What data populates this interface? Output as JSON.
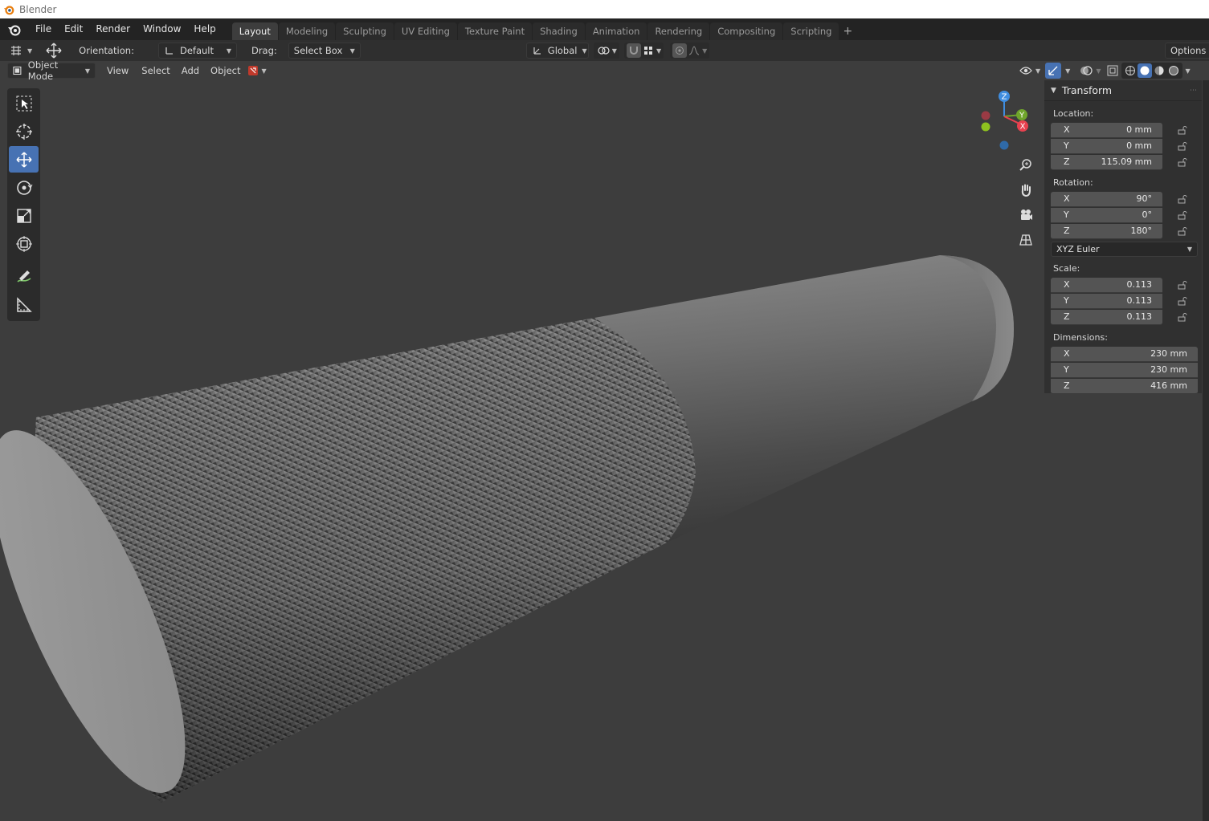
{
  "window": {
    "title": "Blender"
  },
  "menu": [
    "File",
    "Edit",
    "Render",
    "Window",
    "Help"
  ],
  "workspaces": [
    {
      "label": "Layout",
      "active": true
    },
    {
      "label": "Modeling"
    },
    {
      "label": "Sculpting"
    },
    {
      "label": "UV Editing"
    },
    {
      "label": "Texture Paint"
    },
    {
      "label": "Shading"
    },
    {
      "label": "Animation"
    },
    {
      "label": "Rendering"
    },
    {
      "label": "Compositing"
    },
    {
      "label": "Scripting"
    }
  ],
  "tool_header": {
    "orientation_label": "Orientation:",
    "orientation_value": "Default",
    "drag_label": "Drag:",
    "drag_value": "Select Box",
    "transform_orientation": "Global",
    "options_label": "Options"
  },
  "viewport_header": {
    "mode": "Object Mode",
    "view": "View",
    "select": "Select",
    "add": "Add",
    "object": "Object"
  },
  "gizmo": {
    "z": "Z",
    "y": "Y",
    "x": "X"
  },
  "transform_panel": {
    "title": "Transform",
    "location_label": "Location:",
    "location": [
      {
        "axis": "X",
        "value": "0 mm"
      },
      {
        "axis": "Y",
        "value": "0 mm"
      },
      {
        "axis": "Z",
        "value": "115.09 mm"
      }
    ],
    "rotation_label": "Rotation:",
    "rotation": [
      {
        "axis": "X",
        "value": "90°"
      },
      {
        "axis": "Y",
        "value": "0°"
      },
      {
        "axis": "Z",
        "value": "180°"
      }
    ],
    "rotation_mode": "XYZ Euler",
    "scale_label": "Scale:",
    "scale": [
      {
        "axis": "X",
        "value": "0.113"
      },
      {
        "axis": "Y",
        "value": "0.113"
      },
      {
        "axis": "Z",
        "value": "0.113"
      }
    ],
    "dimensions_label": "Dimensions:",
    "dimensions": [
      {
        "axis": "X",
        "value": "230 mm"
      },
      {
        "axis": "Y",
        "value": "230 mm"
      },
      {
        "axis": "Z",
        "value": "416 mm"
      }
    ]
  },
  "colors": {
    "accent": "#4772b3",
    "axis_x": "#e8414f",
    "axis_y": "#6fa52b",
    "axis_z": "#3f8de0",
    "viewport_bg": "#3d3d3d"
  }
}
